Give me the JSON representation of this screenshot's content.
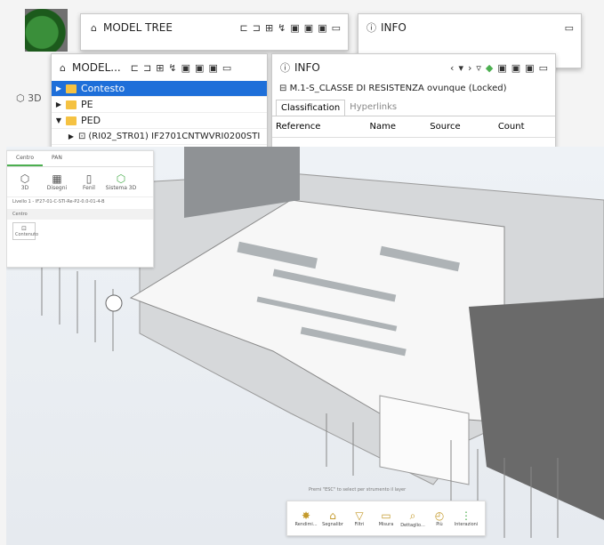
{
  "back_panel": {
    "title": "MODEL TREE",
    "info_title": "INFO"
  },
  "side_label": "3D",
  "model_tree": {
    "title": "MODEL...",
    "rows": [
      {
        "label": "Contesto",
        "selected": true
      },
      {
        "label": "PE",
        "selected": false
      },
      {
        "label": "PED",
        "selected": false
      },
      {
        "label": "(RI02_STR01) IF2701CNTWVRI0200STI",
        "selected": false
      }
    ]
  },
  "info": {
    "title": "INFO",
    "element": "M.1-S_CLASSE DI RESISTENZA ovunque (Locked)",
    "tabs": [
      "Classification",
      "Hyperlinks"
    ],
    "columns": [
      "Reference",
      "Name",
      "Source",
      "Count"
    ]
  },
  "viewer": {
    "tabs": [
      "Centro",
      "PAN"
    ],
    "categories": [
      "3D",
      "Disegni",
      "Fenil",
      "Sistema 3D"
    ],
    "path": "Livello 1 - IF27-01-C-STI-Re-P2-0.0-01-4-B",
    "search": "Centro",
    "side_btn": "Contenuto",
    "hint": "Premi \"ESC\" to select per strumento il layer",
    "bottom_tools": [
      {
        "icon": "target-icon",
        "label": "Rendimi..."
      },
      {
        "icon": "bookmark-icon",
        "label": "Segnalibr"
      },
      {
        "icon": "filter-icon",
        "label": "Filtri"
      },
      {
        "icon": "rect-icon",
        "label": "Misura"
      },
      {
        "icon": "magnifier-icon",
        "label": "Dettaglio..."
      },
      {
        "icon": "clock-icon",
        "label": "Più"
      },
      {
        "icon": "tree-icon",
        "label": "Interazioni"
      }
    ]
  },
  "colors": {
    "selection": "#1e6fd9",
    "folder": "#f5c242",
    "accent": "#4caf50"
  }
}
